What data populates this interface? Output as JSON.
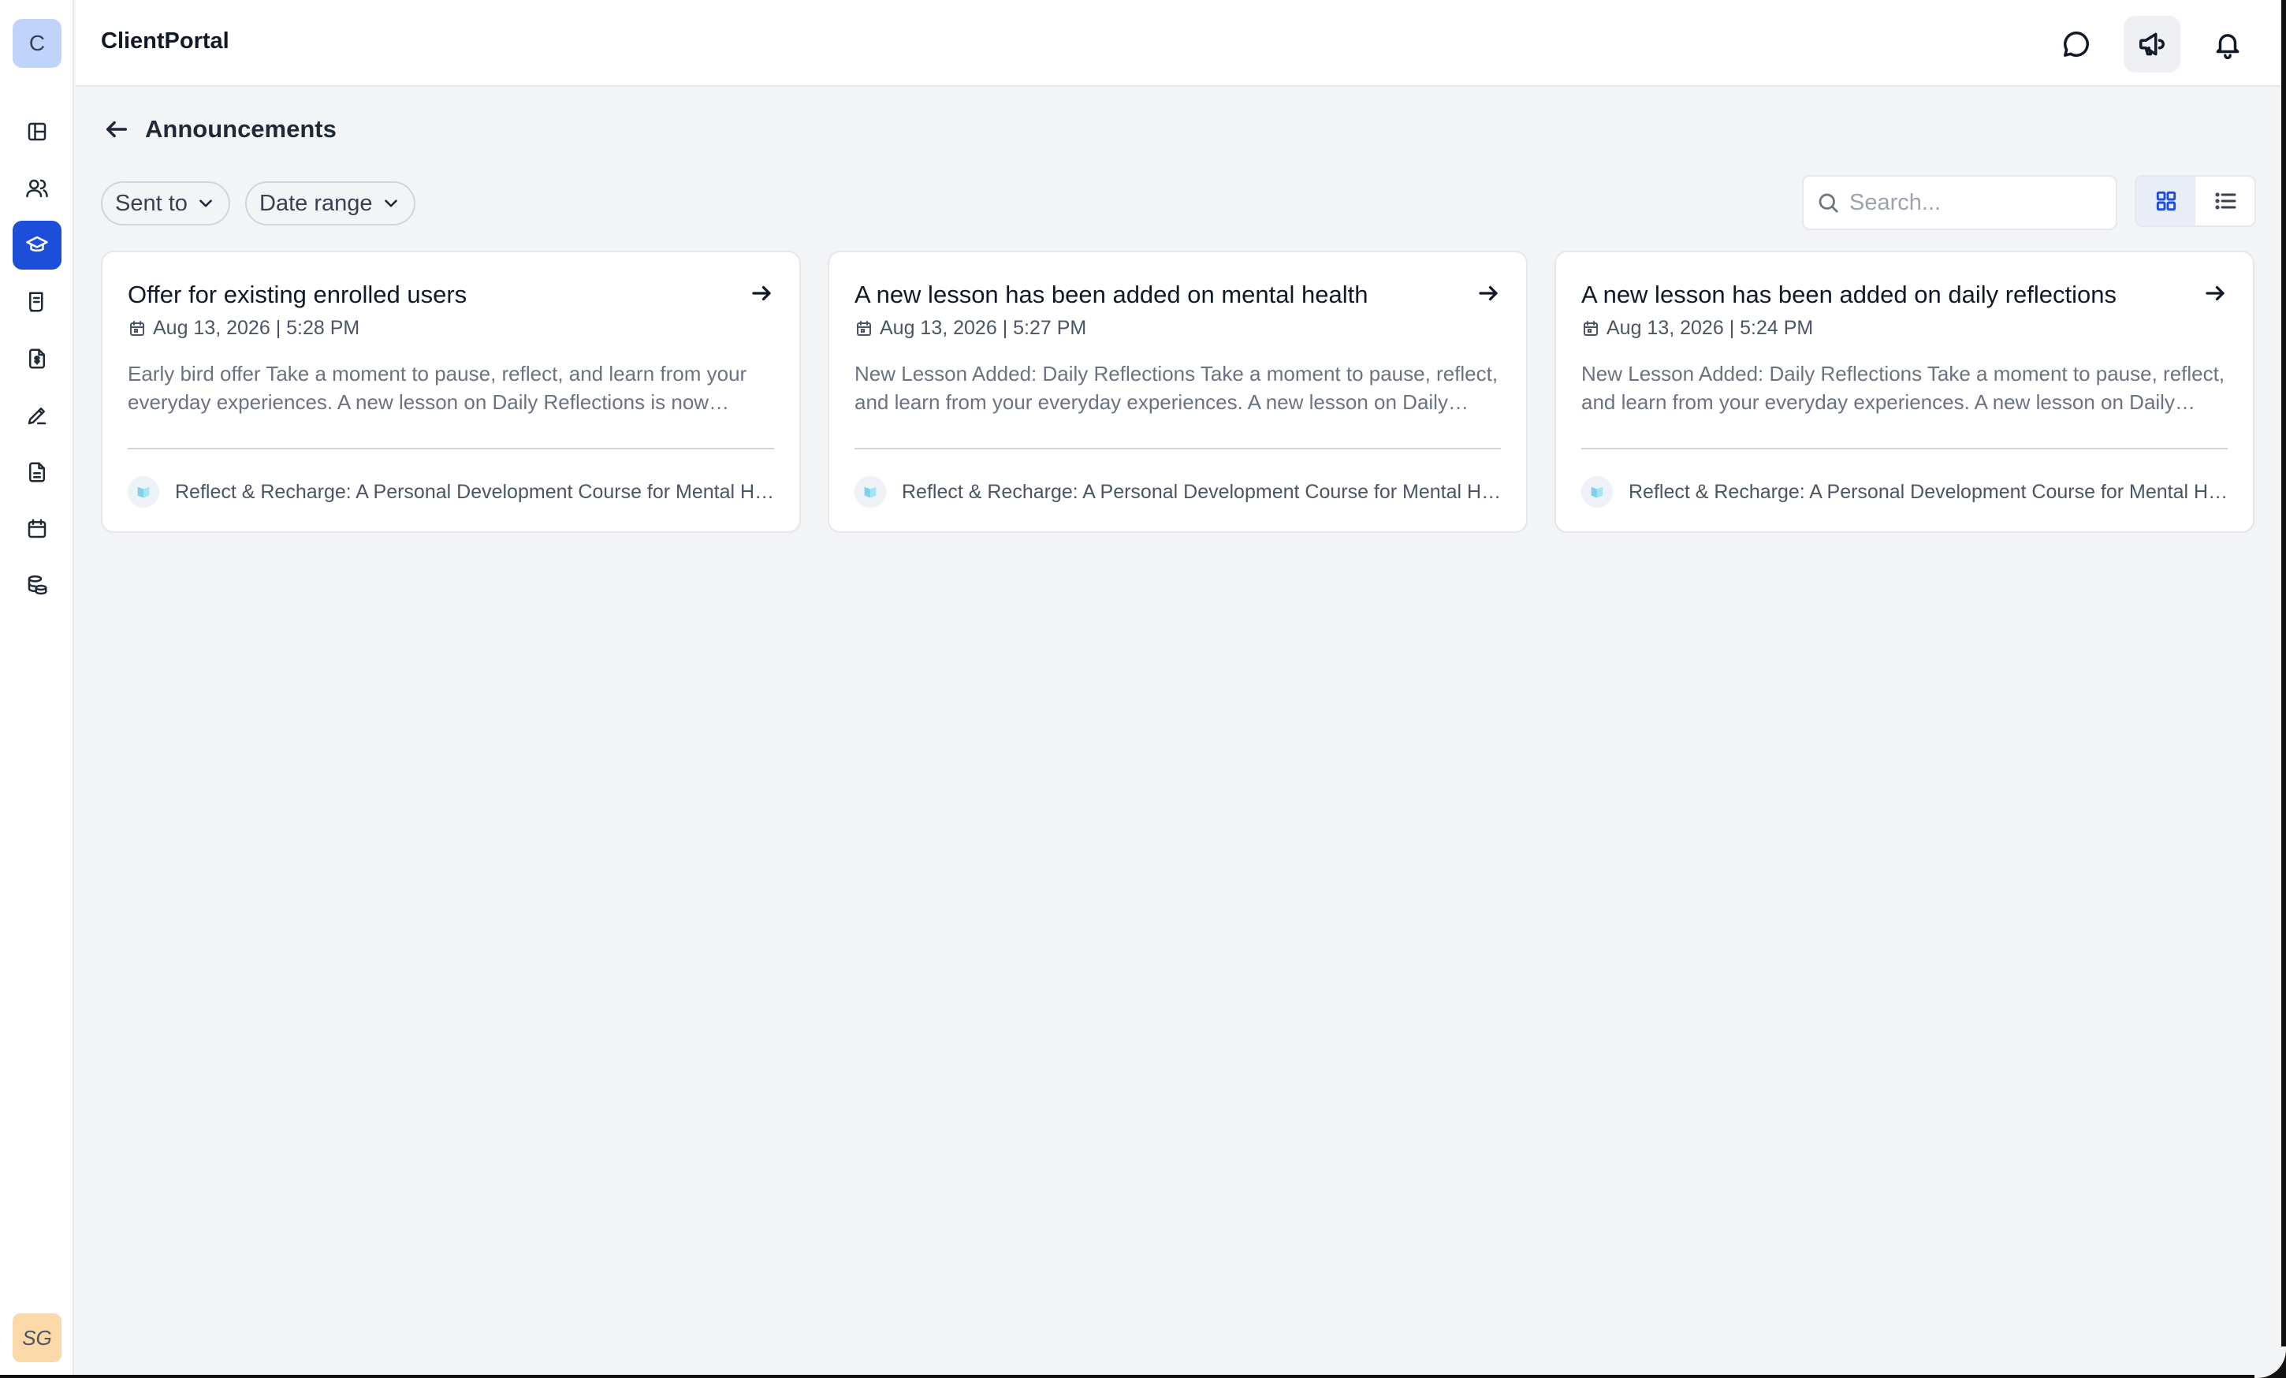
{
  "app": {
    "title": "ClientPortal",
    "logo_letter": "C",
    "user_initials": "SG"
  },
  "sidebar": {
    "items": [
      {
        "name": "layout-icon",
        "active": false
      },
      {
        "name": "users-icon",
        "active": false
      },
      {
        "name": "graduation-cap-icon",
        "active": true
      },
      {
        "name": "receipt-icon",
        "active": false
      },
      {
        "name": "invoice-icon",
        "active": false
      },
      {
        "name": "pen-icon",
        "active": false
      },
      {
        "name": "document-icon",
        "active": false
      },
      {
        "name": "calendar-icon",
        "active": false
      },
      {
        "name": "database-icon",
        "active": false
      }
    ]
  },
  "topbar": {
    "icons": [
      "chat-icon",
      "megaphone-icon",
      "bell-icon"
    ],
    "selected": "megaphone-icon"
  },
  "page": {
    "title": "Announcements"
  },
  "filters": {
    "sent_to": "Sent to",
    "date_range": "Date range"
  },
  "search": {
    "placeholder": "Search..."
  },
  "view": {
    "mode": "grid"
  },
  "colors": {
    "accent": "#1d4ed8",
    "background": "#f3f4f6",
    "logo_bg": "#bfd3fb",
    "avatar_bg": "#fcd9a8"
  },
  "announcements": [
    {
      "title": "Offer for existing enrolled users",
      "date": "Aug 13, 2026 | 5:28 PM",
      "body": "Early bird offer Take a moment to pause, reflect, and learn from your everyday experiences. A new lesson on Daily Reflections is now available for you to explore.",
      "course": "Reflect & Recharge: A Personal Development Course for Mental Health"
    },
    {
      "title": "A new lesson has been added on mental health",
      "date": "Aug 13, 2026 | 5:27 PM",
      "body": "New Lesson Added: Daily Reflections Take a moment to pause, reflect, and learn from your everyday experiences. A new lesson on Daily Reflections is now available.",
      "course": "Reflect & Recharge: A Personal Development Course for Mental Health"
    },
    {
      "title": "A new lesson has been added on daily reflections",
      "date": "Aug 13, 2026 | 5:24 PM",
      "body": "New Lesson Added: Daily Reflections Take a moment to pause, reflect, and learn from your everyday experiences. A new lesson on Daily Reflections is now available.",
      "course": "Reflect & Recharge: A Personal Development Course for Mental Health"
    }
  ]
}
